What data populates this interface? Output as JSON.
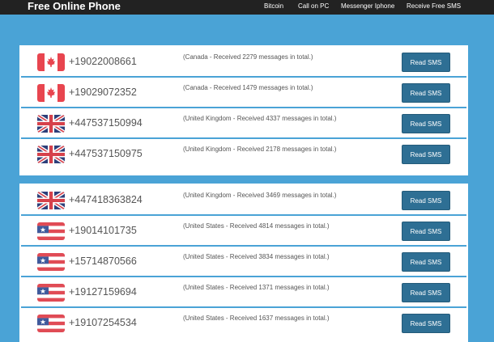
{
  "navbar": {
    "brand": "Free Online Phone",
    "links": [
      "Bitcoin",
      "Call on PC",
      "Messenger Iphone",
      "Receive Free SMS"
    ]
  },
  "colors": {
    "page_background": "#4aa3d6",
    "button": "#2e6f94",
    "navbar": "#222222"
  },
  "button_label": "Read SMS",
  "numbers": [
    {
      "phone": "+19022008661",
      "flag": "canada-flag-icon",
      "country": "Canada",
      "count": "2279",
      "desc_pre": "(Canada - Received ",
      "desc_post": " messages in total.)"
    },
    {
      "phone": "+19029072352",
      "flag": "canada-flag-icon",
      "country": "Canada",
      "count": "1479",
      "desc_pre": "(Canada - Received ",
      "desc_post": " messages in total.)"
    },
    {
      "phone": "+447537150994",
      "flag": "uk-flag-icon",
      "country": "United Kingdom",
      "count": "4337",
      "desc_pre": "(United Kingdom - Received ",
      "desc_post": " messages in total.)"
    },
    {
      "phone": "+447537150975",
      "flag": "uk-flag-icon",
      "country": "United Kingdom",
      "count": "2178",
      "desc_pre": "(United Kingdom - Received ",
      "desc_post": " messages in total.)"
    },
    {
      "phone": "+447418363824",
      "flag": "uk-flag-icon",
      "country": "United Kingdom",
      "count": "3469",
      "desc_pre": "(United Kingdom - Received ",
      "desc_post": " messages in total.)"
    },
    {
      "phone": "+19014101735",
      "flag": "us-flag-icon",
      "country": "United States",
      "count": "4814",
      "desc_pre": "(United States - Received ",
      "desc_post": " messages in total.)"
    },
    {
      "phone": "+15714870566",
      "flag": "us-flag-icon",
      "country": "United States",
      "count": "3834",
      "desc_pre": "(United States - Received ",
      "desc_post": " messages in total.)"
    },
    {
      "phone": "+19127159694",
      "flag": "us-flag-icon",
      "country": "United States",
      "count": "1371",
      "desc_pre": "(United States - Received ",
      "desc_post": " messages in total.)"
    },
    {
      "phone": "+19107254534",
      "flag": "us-flag-icon",
      "country": "United States",
      "count": "1637",
      "desc_pre": "(United States - Received ",
      "desc_post": " messages in total.)"
    }
  ]
}
